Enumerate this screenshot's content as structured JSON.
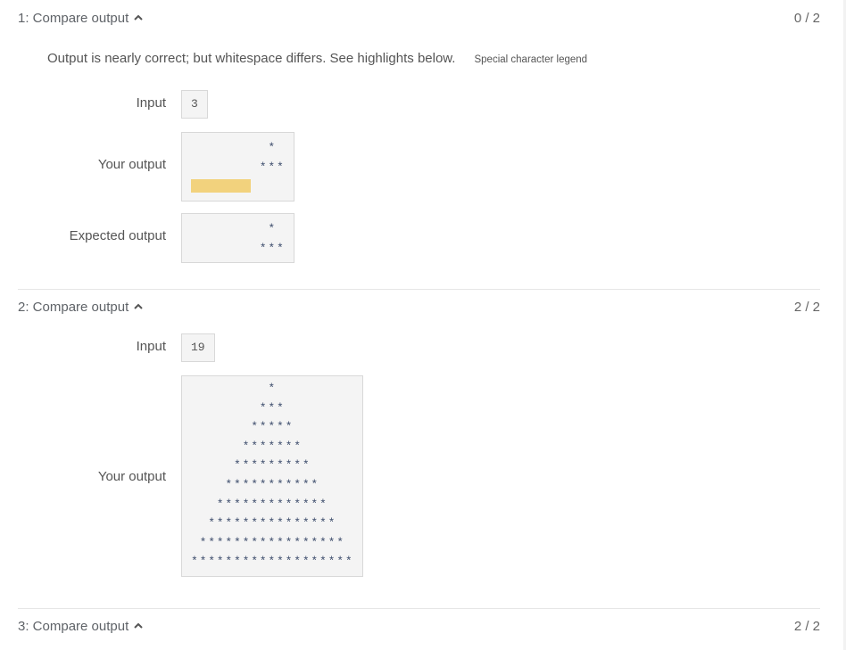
{
  "tests": [
    {
      "title": "1: Compare output",
      "score": "0 / 2",
      "message": "Output is nearly correct; but whitespace differs. See highlights below.",
      "legend_link": "Special character legend",
      "input_label": "Input",
      "input": "3",
      "your_output_label": "Your output",
      "your_output_lines": [
        "         *",
        "        ***"
      ],
      "your_output_highlight": "       ",
      "expected_output_label": "Expected output",
      "expected_output": "         *\n        ***"
    },
    {
      "title": "2: Compare output",
      "score": "2 / 2",
      "input_label": "Input",
      "input": "19",
      "your_output_label": "Your output",
      "your_output": "         *\n        ***\n       *****\n      *******\n     *********\n    ***********\n   *************\n  ***************\n *****************\n*******************"
    },
    {
      "title": "3: Compare output",
      "score": "2 / 2"
    }
  ],
  "colors": {
    "highlight": "#f2d27d",
    "box_bg": "#f4f4f4"
  },
  "icons": {
    "collapse": "chevron-up-icon"
  }
}
